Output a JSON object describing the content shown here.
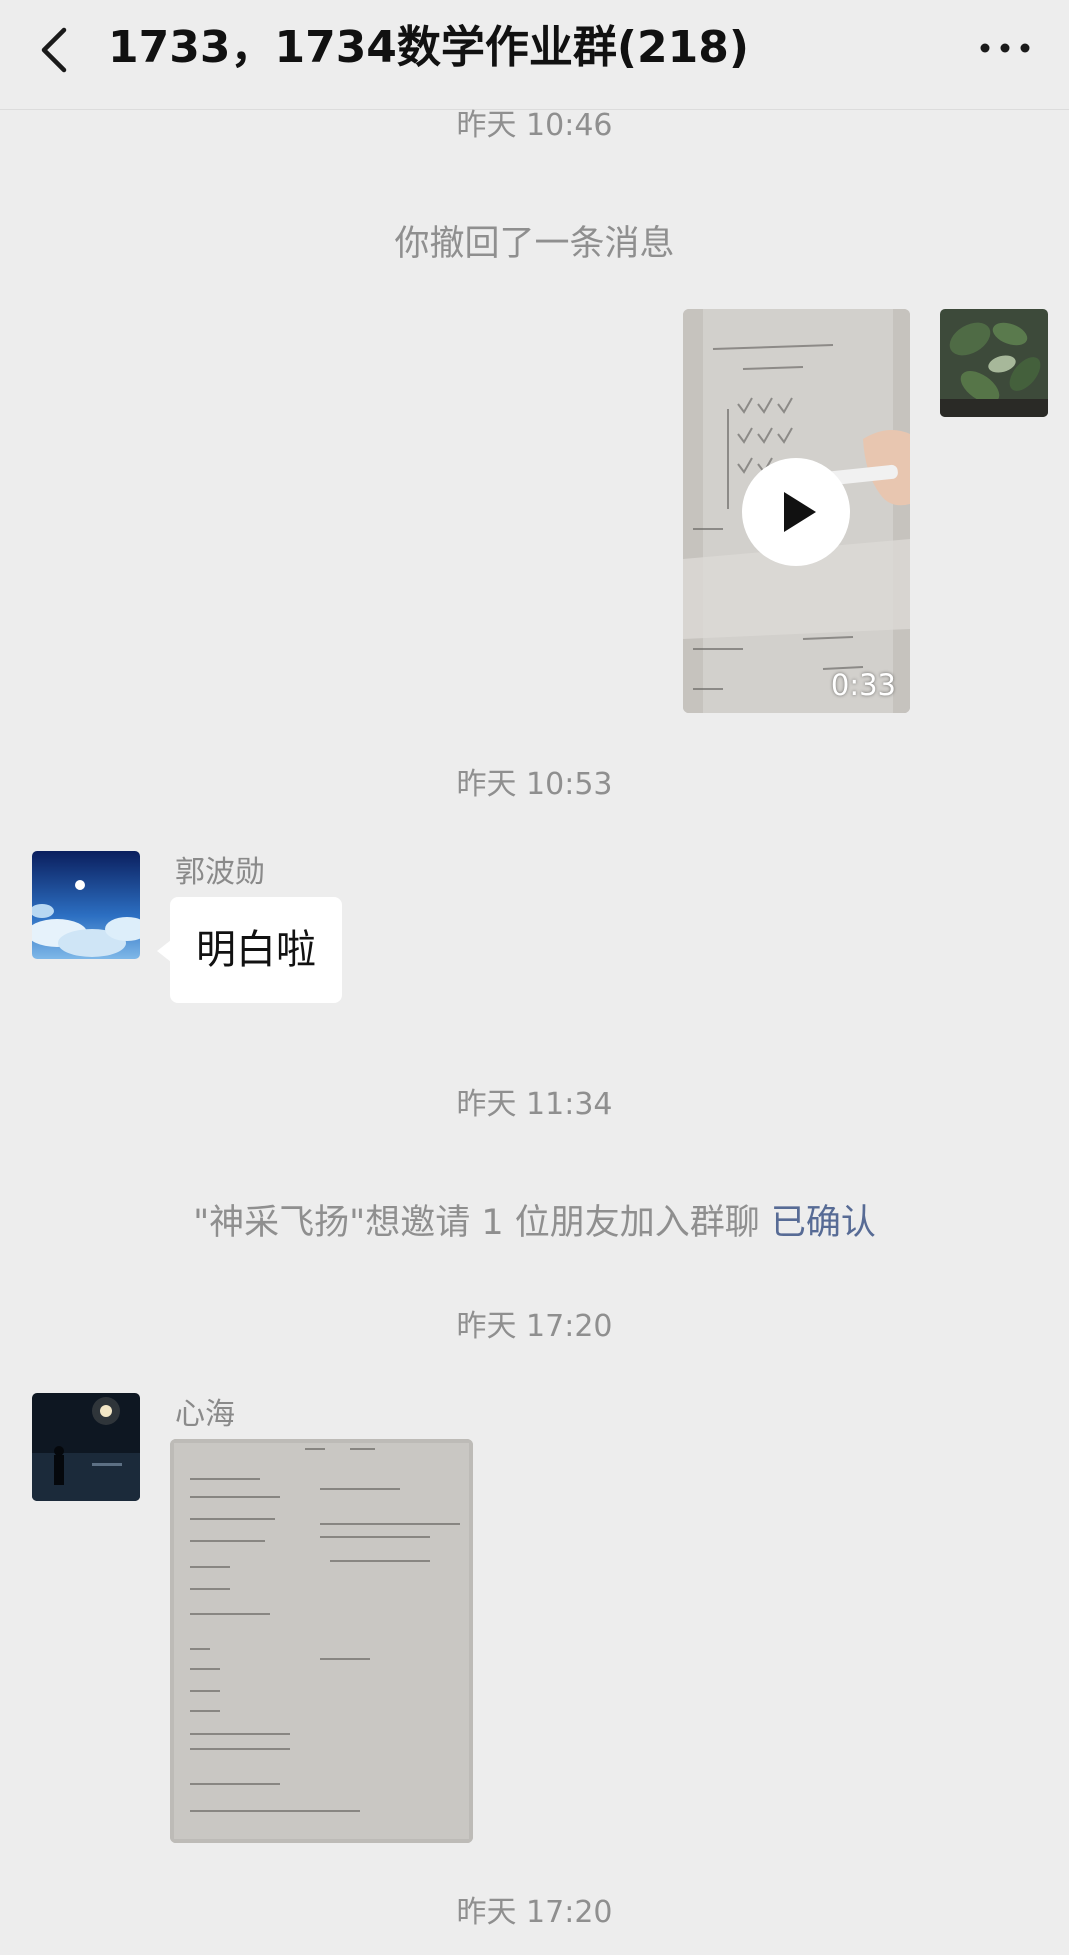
{
  "header": {
    "title": "1733，1734数学作业群(218)",
    "back_icon": "chevron-left-icon",
    "more_icon": "more-horizontal-icon"
  },
  "messages": {
    "time_1": "昨天 10:46",
    "recall_notice": "你撤回了一条消息",
    "video": {
      "duration": "0:33",
      "play_icon": "play-icon"
    },
    "time_2": "昨天 10:53",
    "msg_text": {
      "sender": "郭波勋",
      "text": "明白啦"
    },
    "time_3": "昨天 11:34",
    "invite_notice": {
      "text": "\"神采飞扬\"想邀请 1 位朋友加入群聊",
      "link": "已确认"
    },
    "time_4": "昨天 17:20",
    "msg_image": {
      "sender": "心海"
    },
    "time_5": "昨天 17:20"
  },
  "colors": {
    "background": "#ededed",
    "bubble": "#ffffff",
    "system_text": "#8f8f8f",
    "link": "#576b95"
  }
}
